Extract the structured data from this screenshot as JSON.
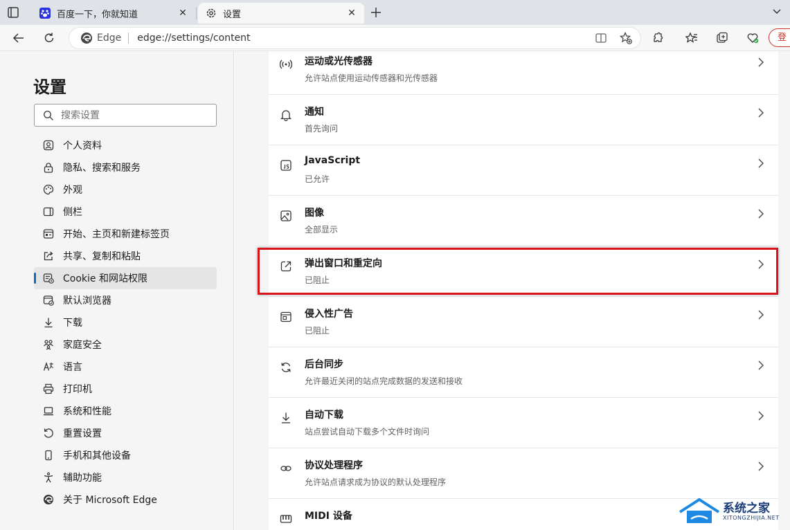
{
  "tabs": [
    {
      "title": "百度一下，你就知道",
      "favicon": "baidu-paw-icon",
      "active": false
    },
    {
      "title": "设置",
      "favicon": "gear-icon",
      "active": true
    }
  ],
  "address_bar": {
    "site_label": "Edge",
    "url": "edge://settings/content"
  },
  "toolbar": {
    "signin_label": "登"
  },
  "sidebar": {
    "title": "设置",
    "search_placeholder": "搜索设置",
    "items": [
      {
        "label": "个人资料",
        "icon": "profile-icon"
      },
      {
        "label": "隐私、搜索和服务",
        "icon": "lock-icon"
      },
      {
        "label": "外观",
        "icon": "palette-icon"
      },
      {
        "label": "侧栏",
        "icon": "sidebar-icon"
      },
      {
        "label": "开始、主页和新建标签页",
        "icon": "home-tabs-icon"
      },
      {
        "label": "共享、复制和粘贴",
        "icon": "share-icon"
      },
      {
        "label": "Cookie 和网站权限",
        "icon": "cookie-permissions-icon",
        "selected": true
      },
      {
        "label": "默认浏览器",
        "icon": "default-browser-icon"
      },
      {
        "label": "下载",
        "icon": "download-icon"
      },
      {
        "label": "家庭安全",
        "icon": "family-icon"
      },
      {
        "label": "语言",
        "icon": "language-icon"
      },
      {
        "label": "打印机",
        "icon": "printer-icon"
      },
      {
        "label": "系统和性能",
        "icon": "laptop-icon"
      },
      {
        "label": "重置设置",
        "icon": "reset-icon"
      },
      {
        "label": "手机和其他设备",
        "icon": "phone-icon"
      },
      {
        "label": "辅助功能",
        "icon": "accessibility-icon"
      },
      {
        "label": "关于 Microsoft Edge",
        "icon": "edge-logo-icon"
      }
    ]
  },
  "permissions": [
    {
      "title": "运动或光传感器",
      "subtitle": "允许站点使用运动传感器和光传感器",
      "icon": "sensor-icon"
    },
    {
      "title": "通知",
      "subtitle": "首先询问",
      "icon": "bell-icon"
    },
    {
      "title": "JavaScript",
      "subtitle": "已允许",
      "icon": "javascript-icon"
    },
    {
      "title": "图像",
      "subtitle": "全部显示",
      "icon": "image-icon"
    },
    {
      "title": "弹出窗口和重定向",
      "subtitle": "已阻止",
      "icon": "popup-icon",
      "highlighted": true
    },
    {
      "title": "侵入性广告",
      "subtitle": "已阻止",
      "icon": "ads-icon"
    },
    {
      "title": "后台同步",
      "subtitle": "允许最近关闭的站点完成数据的发送和接收",
      "icon": "sync-icon"
    },
    {
      "title": "自动下载",
      "subtitle": "站点尝试自动下载多个文件时询问",
      "icon": "download-icon"
    },
    {
      "title": "协议处理程序",
      "subtitle": "允许站点请求成为协议的默认处理程序",
      "icon": "protocol-icon"
    },
    {
      "title": "MIDI 设备",
      "subtitle": "",
      "icon": "midi-icon"
    }
  ],
  "watermark": {
    "name": "系统之家",
    "domain": "XITONGZHIJIA.NET"
  },
  "colors": {
    "accent": "#0f6cbd",
    "highlight_box": "#d7141a",
    "signin": "#c5342b"
  }
}
